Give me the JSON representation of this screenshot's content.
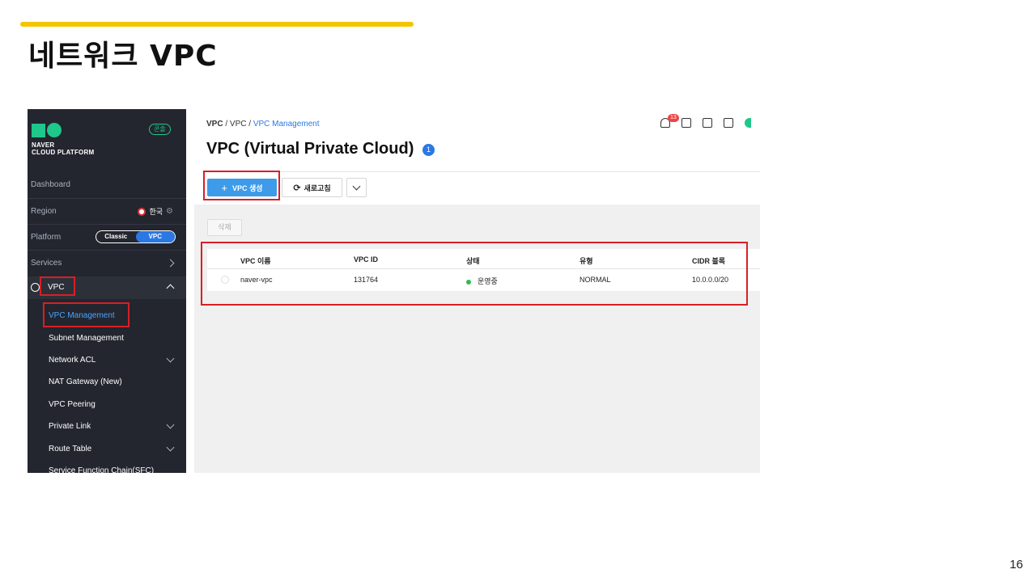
{
  "slide": {
    "title": "네트워크 VPC",
    "page_number": "16"
  },
  "sidebar": {
    "logo_line1": "NAVER",
    "logo_line2": "CLOUD PLATFORM",
    "gov_badge": "콘솔",
    "dashboard": "Dashboard",
    "region_label": "Region",
    "region_value": "한국",
    "platform_label": "Platform",
    "platform_options": [
      "Classic",
      "VPC"
    ],
    "platform_selected": "VPC",
    "services": "Services",
    "vpc_section": "VPC",
    "items": [
      {
        "label": "VPC Management",
        "active": true
      },
      {
        "label": "Subnet Management"
      },
      {
        "label": "Network ACL"
      },
      {
        "label": "NAT Gateway (New)"
      },
      {
        "label": "VPC Peering"
      },
      {
        "label": "Private Link"
      },
      {
        "label": "Route Table"
      },
      {
        "label": "Service Function Chain(SFC)"
      }
    ]
  },
  "header": {
    "breadcrumb": [
      "VPC",
      "VPC",
      "VPC Management"
    ],
    "notification_count": "13",
    "title": "VPC (Virtual Private Cloud)",
    "info_badge": "1"
  },
  "toolbar": {
    "create_label": "VPC 생성",
    "refresh_label": "새로고침",
    "delete_label": "삭제"
  },
  "table": {
    "columns": [
      "VPC 이름",
      "VPC ID",
      "상태",
      "유형",
      "CIDR 블록"
    ],
    "rows": [
      [
        "naver-vpc",
        "131764",
        "운영중",
        "NORMAL",
        "10.0.0.0/20"
      ]
    ]
  },
  "colors": {
    "accent_yellow": "#f5c400",
    "sidebar_bg": "#23262f",
    "brand_green": "#1ec78a",
    "primary_blue": "#3d9be9",
    "highlight_red": "#d81f26",
    "status_green": "#2dbd4e"
  }
}
